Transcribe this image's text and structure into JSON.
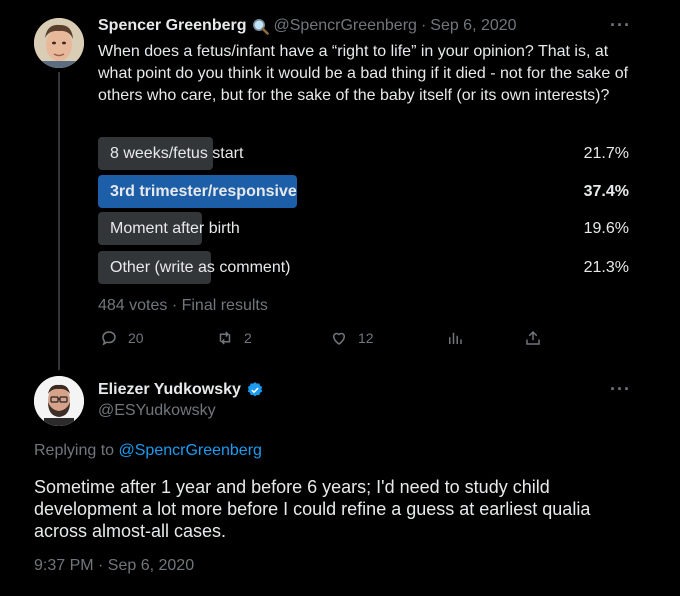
{
  "tweet": {
    "author_name": "Spencer Greenberg",
    "author_handle": "@SpencrGreenberg",
    "separator": "·",
    "date": "Sep 6, 2020",
    "more": "···",
    "text": "When does a fetus/infant have a “right to life” in your opinion? That is, at what point do you think it would be a bad thing if it died - not for the sake of others who care, but for the sake of the baby itself (or its own interests)?",
    "poll": {
      "options": [
        {
          "label": "8 weeks/fetus start",
          "percent_text": "21.7%",
          "percent": 21.7,
          "winner": false
        },
        {
          "label": "3rd trimester/responsive",
          "percent_text": "37.4%",
          "percent": 37.4,
          "winner": true
        },
        {
          "label": "Moment after birth",
          "percent_text": "19.6%",
          "percent": 19.6,
          "winner": false
        },
        {
          "label": "Other (write as comment)",
          "percent_text": "21.3%",
          "percent": 21.3,
          "winner": false
        }
      ],
      "footer": "484 votes · Final results"
    },
    "actions": {
      "replies": "20",
      "retweets": "2",
      "likes": "12"
    },
    "icons": [
      "magnifier-emoji-icon",
      "reply-icon",
      "retweet-icon",
      "like-icon",
      "analytics-icon",
      "share-icon"
    ]
  },
  "reply": {
    "author_name": "Eliezer Yudkowsky",
    "author_handle": "@ESYudkowsky",
    "more": "···",
    "replying_prefix": "Replying to ",
    "replying_to": "@SpencrGreenberg",
    "text": "Sometime after 1 year and before 6 years; I'd need to study child development a lot more before I could refine a guess at earliest qualia across almost-all cases.",
    "timestamp": "9:37 PM · Sep 6, 2020",
    "verified_color": "#1d9bf0"
  },
  "colors": {
    "background": "#000000",
    "text": "#e7e9ea",
    "muted": "#71767b",
    "accent": "#1d9bf0",
    "poll_bar": "#333639",
    "poll_winner": "#1d5ea8"
  }
}
